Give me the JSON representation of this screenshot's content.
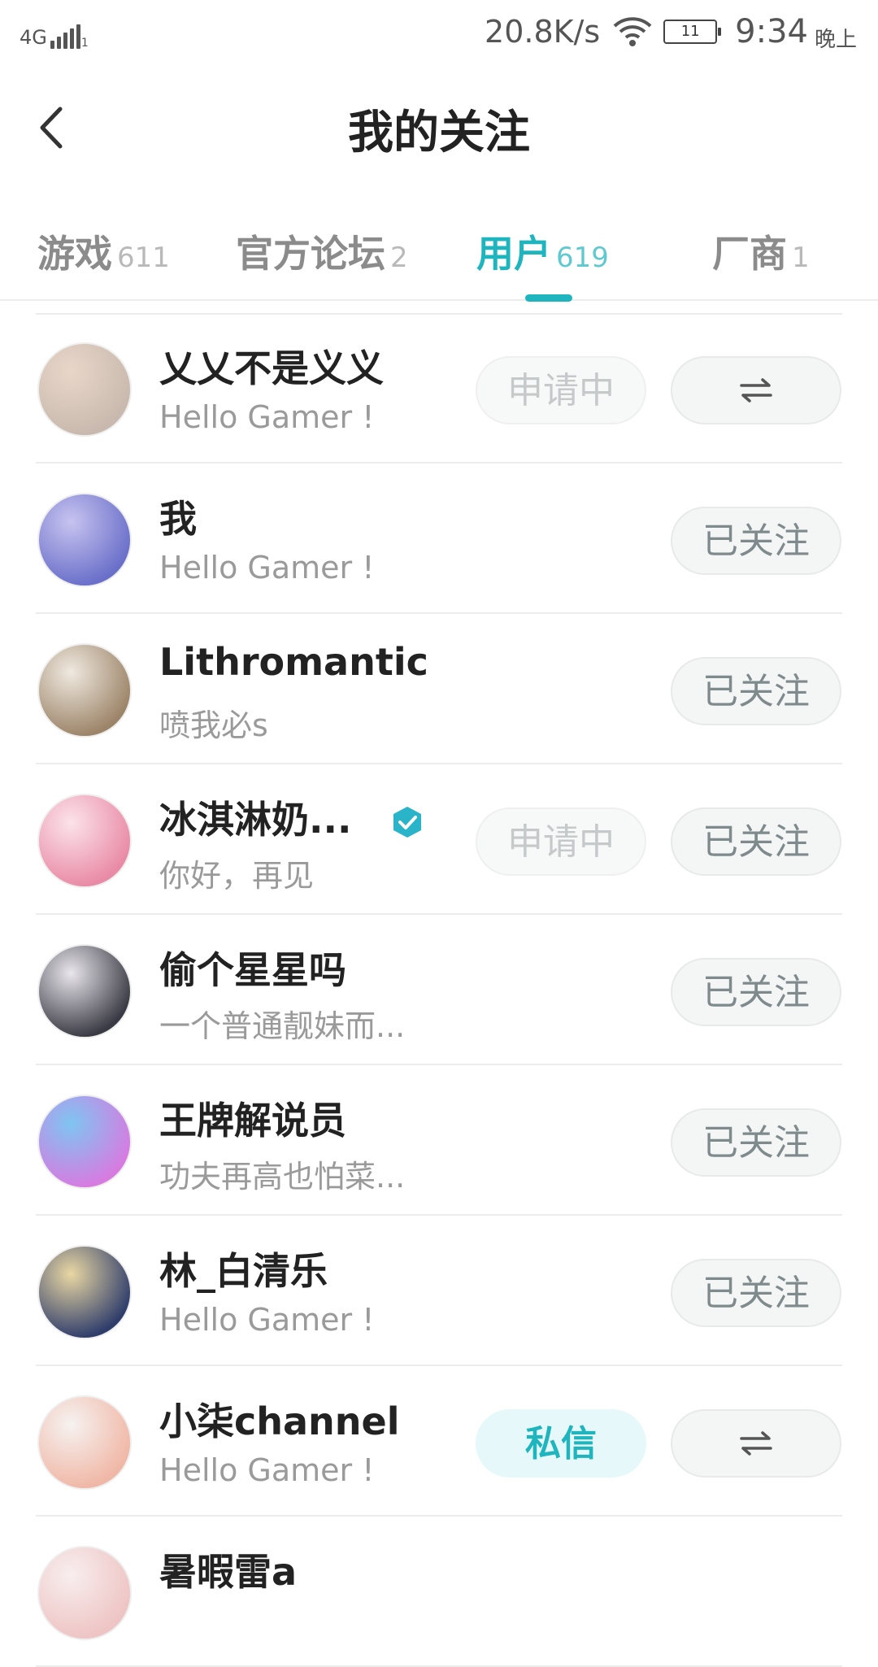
{
  "status_bar": {
    "network": "4G",
    "signal_sub": "1",
    "speed": "20.8K/s",
    "battery": "11",
    "time": "9:34",
    "ampm": "晚上"
  },
  "header": {
    "title": "我的关注",
    "back_icon": "chevron-left-icon"
  },
  "tabs": [
    {
      "label": "游戏",
      "count": "611",
      "active": false
    },
    {
      "label": "官方论坛",
      "count": "2",
      "active": false
    },
    {
      "label": "用户",
      "count": "619",
      "active": true
    },
    {
      "label": "厂商",
      "count": "1",
      "active": false
    }
  ],
  "colors": {
    "accent": "#1fb5bf",
    "verified": "#2ab4c9"
  },
  "users": [
    {
      "name": "乂乂不是义义",
      "subtitle": "Hello Gamer !",
      "primary_button": "申请中",
      "secondary_button": "swap-arrows-icon",
      "verified": false,
      "avatar_colors": [
        "#c9b8ad",
        "#e8d7c9"
      ]
    },
    {
      "name": "我",
      "subtitle": "Hello Gamer !",
      "primary_button": "",
      "secondary_button": "已关注",
      "verified": false,
      "avatar_colors": [
        "#6a6fc9",
        "#c7c3f0"
      ]
    },
    {
      "name": "Lithromantic",
      "subtitle": "喷我必s",
      "primary_button": "",
      "secondary_button": "已关注",
      "verified": false,
      "avatar_colors": [
        "#9c8468",
        "#efe9e0"
      ]
    },
    {
      "name": "冰淇淋奶...",
      "subtitle": "你好，再见",
      "primary_button": "申请中",
      "secondary_button": "已关注",
      "verified": true,
      "avatar_colors": [
        "#e98aa6",
        "#fbe3ea"
      ]
    },
    {
      "name": "偷个星星吗",
      "subtitle": "一个普通靓妹而...",
      "primary_button": "",
      "secondary_button": "已关注",
      "verified": false,
      "avatar_colors": [
        "#3a3a44",
        "#e9e6ec"
      ]
    },
    {
      "name": "王牌解说员",
      "subtitle": "功夫再高也怕菜...",
      "primary_button": "",
      "secondary_button": "已关注",
      "verified": false,
      "avatar_colors": [
        "#d77be0",
        "#7ec5f2"
      ]
    },
    {
      "name": "林_白清乐",
      "subtitle": "Hello Gamer !",
      "primary_button": "",
      "secondary_button": "已关注",
      "verified": false,
      "avatar_colors": [
        "#2f3d6b",
        "#e9d7a3"
      ]
    },
    {
      "name": "小柒channel",
      "subtitle": "Hello Gamer !",
      "primary_button": "私信",
      "secondary_button": "swap-arrows-icon",
      "verified": false,
      "avatar_colors": [
        "#f0b7a6",
        "#f6f2f0"
      ]
    },
    {
      "name": "暑暇雷a",
      "subtitle": "",
      "primary_button": "",
      "secondary_button": "",
      "verified": false,
      "avatar_colors": [
        "#eec4c4",
        "#f8eeee"
      ]
    }
  ]
}
